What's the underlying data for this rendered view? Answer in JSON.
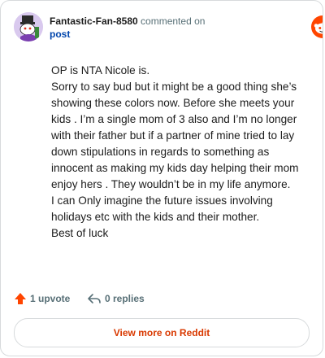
{
  "comment": {
    "username": "Fantastic-Fan-8580",
    "action_text": "commented on",
    "post_link_text": "post",
    "paragraphs": [
      "OP is NTA Nicole is.",
      "Sorry to say bud but it might be a good thing she’s showing these colors now. Before she meets your kids . I’m a single mom of 3 also and I’m no longer with their father but if a partner of mine tried to lay down stipulations in regards to something as innocent as making my kids day helping their mom enjoy hers . They wouldn’t be in my life anymore.",
      "I can Only imagine the future issues involving holidays etc with the kids and their mother.",
      "Best of luck"
    ],
    "upvotes_label": "1 upvote",
    "replies_label": "0 replies"
  },
  "brand": {
    "wordmark": "reddit",
    "accent_color": "#ff4500"
  },
  "cta": {
    "view_more_label": "View more on Reddit"
  },
  "icons": {
    "avatar": "snoo-avatar",
    "logo": "reddit-snoo-icon",
    "upvote": "upvote-arrow-icon",
    "reply": "reply-arrow-icon"
  }
}
